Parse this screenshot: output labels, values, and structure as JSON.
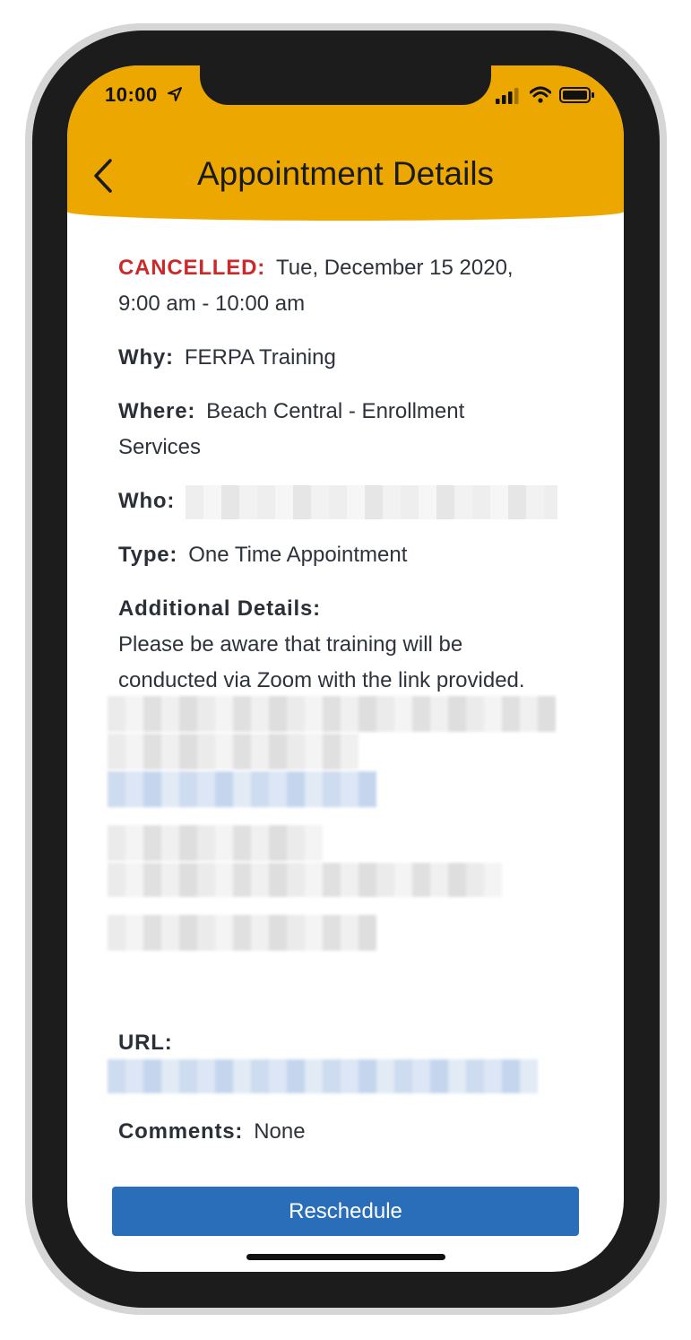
{
  "status_bar": {
    "time": "10:00"
  },
  "header": {
    "title": "Appointment Details",
    "background": "#eca800"
  },
  "appointment": {
    "status": "CANCELLED:",
    "status_color": "#cc2a2a",
    "date_line1": "Tue, December 15 2020,",
    "date_line2": "9:00 am - 10:00 am",
    "why_label": "Why:",
    "why_value": "FERPA Training",
    "where_label": "Where:",
    "where_value_line1": "Beach Central - Enrollment",
    "where_value_line2": "Services",
    "who_label": "Who:",
    "type_label": "Type:",
    "type_value": "One Time Appointment",
    "details_label": "Additional Details:",
    "details_line1": "Please be aware that training will be",
    "details_line2": "conducted via Zoom with the link provided.",
    "url_label": "URL:",
    "comments_label": "Comments:",
    "comments_value": "None"
  },
  "actions": {
    "reschedule_label": "Reschedule",
    "accent": "#2a6db8"
  },
  "icons": [
    "back-chevron-icon",
    "location-arrow-icon",
    "cellular-signal-icon",
    "wifi-icon",
    "battery-icon"
  ]
}
